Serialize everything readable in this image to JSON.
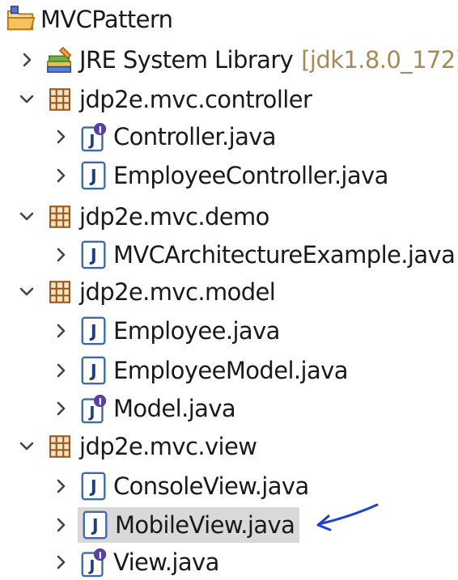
{
  "project": {
    "name": "MVCPattern",
    "icon": "project-folder-icon"
  },
  "library": {
    "name": "JRE System Library",
    "suffix": "[jdk1.8.0_172]",
    "icon": "library-icon",
    "expanded": false
  },
  "packages": [
    {
      "name": "jdp2e.mvc.controller",
      "expanded": true,
      "files": [
        {
          "name": "Controller.java",
          "icon": "interface-java-file-icon"
        },
        {
          "name": "EmployeeController.java",
          "icon": "java-file-icon"
        }
      ]
    },
    {
      "name": "jdp2e.mvc.demo",
      "expanded": true,
      "files": [
        {
          "name": "MVCArchitectureExample.java",
          "icon": "java-file-icon"
        }
      ]
    },
    {
      "name": "jdp2e.mvc.model",
      "expanded": true,
      "files": [
        {
          "name": "Employee.java",
          "icon": "java-file-icon"
        },
        {
          "name": "EmployeeModel.java",
          "icon": "java-file-icon"
        },
        {
          "name": "Model.java",
          "icon": "interface-java-file-icon"
        }
      ]
    },
    {
      "name": "jdp2e.mvc.view",
      "expanded": true,
      "files": [
        {
          "name": "ConsoleView.java",
          "icon": "java-file-icon"
        },
        {
          "name": "MobileView.java",
          "icon": "java-file-icon",
          "selected": true
        },
        {
          "name": "View.java",
          "icon": "interface-java-file-icon"
        }
      ]
    }
  ],
  "colors": {
    "package_icon": "#b5651d",
    "java_file_border": "#3f6aa8",
    "interface_badge": "#5b3fa0",
    "selection": "#d9d9d9",
    "annotation_arrow": "#1f3fd6",
    "library_suffix": "#a88a59"
  }
}
